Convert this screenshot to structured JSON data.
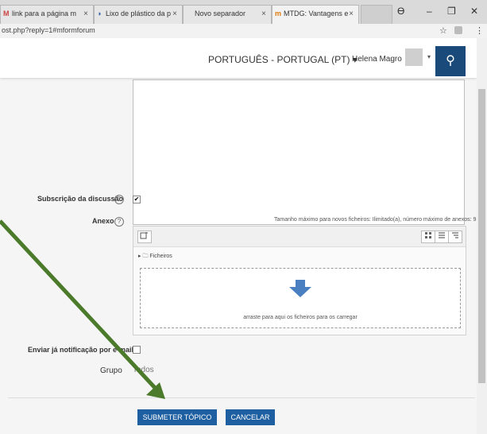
{
  "browser": {
    "tabs": [
      {
        "icon": "M",
        "title": "link para a página m"
      },
      {
        "icon": "◑",
        "title": "Lixo de plástico da p"
      },
      {
        "icon": "",
        "title": "Novo separador"
      },
      {
        "icon": "m",
        "title": "MTDG: Vantagens e"
      }
    ],
    "close_glyph": "×",
    "url": "ost.php?reply=1#mformforum",
    "account_icon": "ϴ",
    "minimize": "–",
    "maximize": "❐",
    "close": "✕",
    "star": "☆",
    "menu": "⋮"
  },
  "navbar": {
    "language": "PORTUGUÊS - PORTUGAL (PT) ▾",
    "user": "Helena Magro",
    "caret": "▾",
    "search_glyph": "⚲"
  },
  "form": {
    "subscription_label": "Subscrição da discussão",
    "subscription_checked": "✔",
    "attachment_label": "Anexo",
    "help_glyph": "?",
    "max_info": "Tamanho máximo para novos ficheiros: Ilimitado(a), número máximo de anexos: 9",
    "files_folder": "▸ 🗀 Ficheiros",
    "drop_text": "arraste para aqui os ficheiros para os carregar",
    "notify_label": "Enviar já notificação por e-mail",
    "group_label": "Grupo",
    "group_value": "Todos",
    "submit": "SUBMETER TÓPICO",
    "cancel": "CANCELAR"
  },
  "colors": {
    "accent": "#1d5fa0",
    "annotation_arrow": "#4a7a2a"
  },
  "icons": {
    "add_file": "add-file-icon",
    "grid_view": "grid-view-icon",
    "list_view": "list-view-icon",
    "tree_view": "tree-view-icon"
  }
}
